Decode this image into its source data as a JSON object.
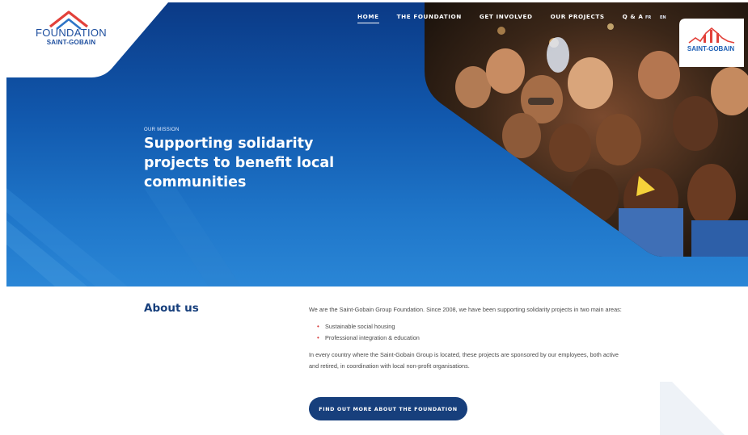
{
  "brand": {
    "logo_title": "FOUNDATION",
    "logo_subtitle": "SAINT-GOBAIN",
    "badge_label": "SAINT-GOBAIN"
  },
  "nav": {
    "items": [
      {
        "label": "HOME",
        "active": true
      },
      {
        "label": "THE FOUNDATION",
        "active": false
      },
      {
        "label": "GET INVOLVED",
        "active": false
      },
      {
        "label": "OUR PROJECTS",
        "active": false
      },
      {
        "label": "Q & A",
        "active": false
      }
    ],
    "lang_fr": "FR",
    "lang_en": "EN"
  },
  "hero": {
    "kicker": "OUR MISSION",
    "title_bold": "Supporting solidarity projects",
    "title_rest": " to benefit local communities"
  },
  "about": {
    "heading": "About us",
    "intro": "We are the Saint-Gobain Group Foundation. Since 2008, we have been supporting solidarity projects in two main areas:",
    "areas": [
      "Sustainable social housing",
      "Professional integration & education"
    ],
    "closing": "In every country where the Saint-Gobain Group is located, these projects are sponsored by our employees, both active and retired, in coordination with local non-profit organisations.",
    "cta_label": "FIND OUT MORE ABOUT THE FOUNDATION"
  },
  "icons": {
    "logo_roof": "roof-icon",
    "list_bullet": "bullet-icon"
  },
  "colors": {
    "brand_blue": "#173f7c",
    "hero_top": "#0b3a86",
    "hero_bottom": "#2a86d6",
    "bullet_red": "#d63b3b",
    "logo_red": "#e2413a"
  }
}
